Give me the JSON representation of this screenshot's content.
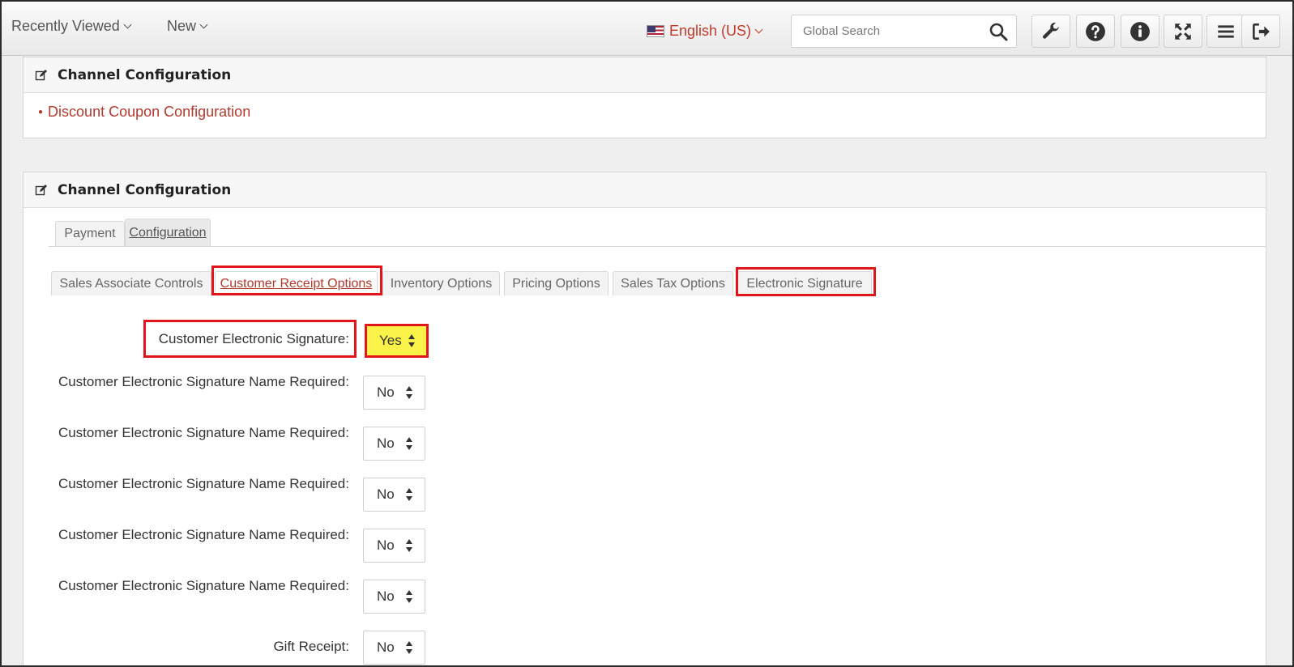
{
  "topbar": {
    "recently_viewed": "Recently Viewed",
    "new": "New",
    "language": "English (US)",
    "search_placeholder": "Global Search",
    "tools": [
      "wrench-icon",
      "help-icon",
      "info-icon",
      "expand-icon",
      "menu-icon",
      "logout-icon"
    ]
  },
  "panel1": {
    "title": "Channel Configuration",
    "link": "Discount Coupon Configuration"
  },
  "panel2": {
    "title": "Channel Configuration",
    "tabs": [
      "Payment",
      "Configuration"
    ],
    "subtabs": [
      "Sales Associate Controls",
      "Customer Receipt Options",
      "Inventory Options",
      "Pricing Options",
      "Sales Tax Options",
      "Electronic Signature"
    ],
    "fields": [
      {
        "label": "Customer Electronic Signature:",
        "value": "Yes"
      },
      {
        "label": "Customer Electronic Signature Name Required:",
        "value": "No"
      },
      {
        "label": "Customer Electronic Signature Name Required:",
        "value": "No"
      },
      {
        "label": "Customer Electronic Signature Name Required:",
        "value": "No"
      },
      {
        "label": "Customer Electronic Signature Name Required:",
        "value": "No"
      },
      {
        "label": "Customer Electronic Signature Name Required:",
        "value": "No"
      },
      {
        "label": "Gift Receipt:",
        "value": "No"
      }
    ]
  },
  "colors": {
    "highlight": "#e0161b",
    "yes_bg": "#fbf34a",
    "link": "#b03a2e"
  }
}
